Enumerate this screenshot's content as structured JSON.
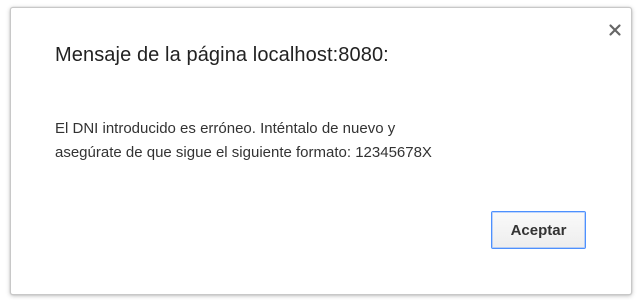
{
  "dialog": {
    "title": "Mensaje de la página localhost:8080:",
    "message_line1": "El DNI introducido es erróneo. Inténtalo de nuevo y",
    "message_line2": "asegúrate de que sigue el siguiente formato: 12345678X",
    "accept_label": "Aceptar",
    "close_icon": "close-icon"
  },
  "colors": {
    "accent": "#4d90fe",
    "text": "#333333",
    "border": "#c8c8c8"
  }
}
